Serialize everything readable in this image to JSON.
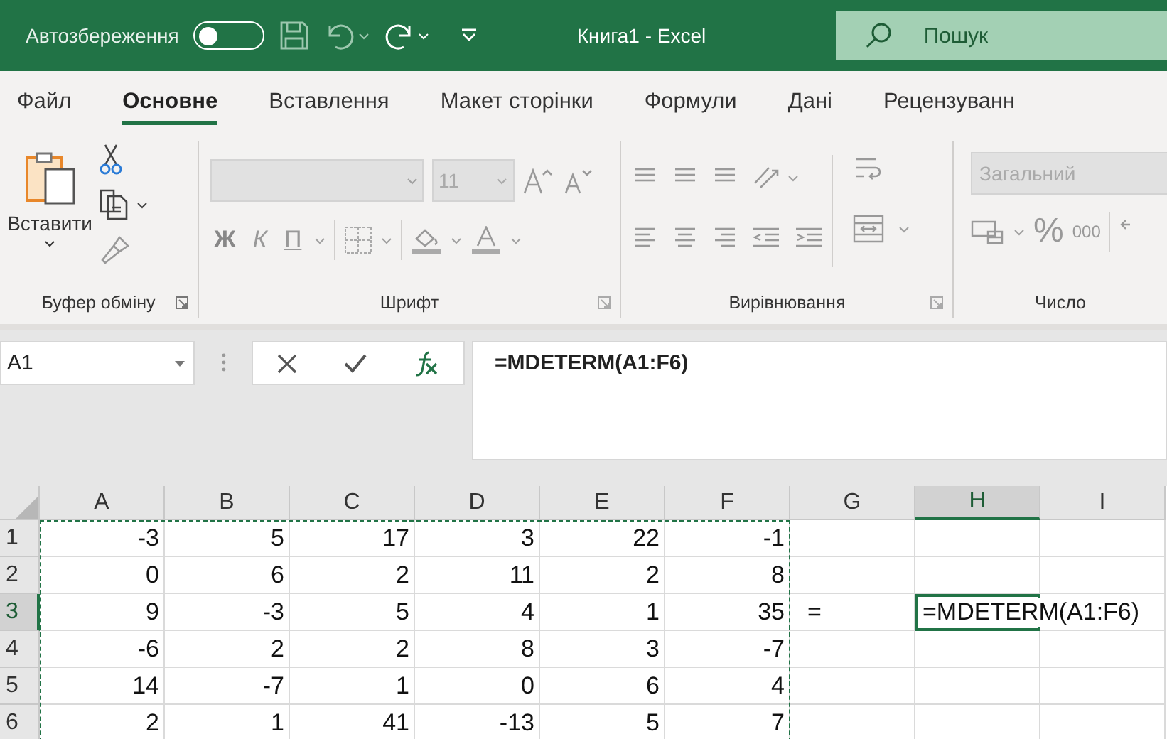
{
  "title_bar": {
    "autosave_label": "Автозбереження",
    "autosave_on": false,
    "title": "Книга1  -  Excel",
    "search_placeholder": "Пошук"
  },
  "tabs": [
    {
      "label": "Файл",
      "selected": false
    },
    {
      "label": "Основне",
      "selected": true
    },
    {
      "label": "Вставлення",
      "selected": false
    },
    {
      "label": "Макет сторінки",
      "selected": false
    },
    {
      "label": "Формули",
      "selected": false
    },
    {
      "label": "Дані",
      "selected": false
    },
    {
      "label": "Рецензуванн",
      "selected": false
    }
  ],
  "ribbon": {
    "clipboard": {
      "label": "Буфер обміну",
      "paste_label": "Вставити"
    },
    "font": {
      "label": "Шрифт",
      "disabled": true,
      "size": "11",
      "bold": "Ж",
      "italic": "К",
      "underline": "П"
    },
    "alignment": {
      "label": "Вирівнювання",
      "disabled": true
    },
    "number": {
      "label": "Число",
      "disabled": true,
      "format": "Загальний",
      "percent": "%",
      "thousands": "000"
    }
  },
  "formula_bar": {
    "name_box": "A1",
    "formula": "=MDETERM(A1:F6)"
  },
  "grid": {
    "copy_marquee": true,
    "columns": [
      {
        "label": "A",
        "selected": false
      },
      {
        "label": "B",
        "selected": false
      },
      {
        "label": "C",
        "selected": false
      },
      {
        "label": "D",
        "selected": false
      },
      {
        "label": "E",
        "selected": false
      },
      {
        "label": "F",
        "selected": false
      },
      {
        "label": "G",
        "selected": false
      },
      {
        "label": "H",
        "selected": true
      },
      {
        "label": "I",
        "selected": false
      }
    ],
    "rows": [
      {
        "label": "1",
        "selected": false,
        "cells": [
          "-3",
          "5",
          "17",
          "3",
          "22",
          "-1",
          "",
          "",
          ""
        ]
      },
      {
        "label": "2",
        "selected": false,
        "cells": [
          "0",
          "6",
          "2",
          "11",
          "2",
          "8",
          "",
          "",
          ""
        ]
      },
      {
        "label": "3",
        "selected": true,
        "cells": [
          "9",
          "-3",
          "5",
          "4",
          "1",
          "35",
          "=",
          "=MDETERM(A1:F6)",
          ""
        ]
      },
      {
        "label": "4",
        "selected": false,
        "cells": [
          "-6",
          "2",
          "2",
          "8",
          "3",
          "-7",
          "",
          "",
          ""
        ]
      },
      {
        "label": "5",
        "selected": false,
        "cells": [
          "14",
          "-7",
          "1",
          "0",
          "6",
          "4",
          "",
          "",
          ""
        ]
      },
      {
        "label": "6",
        "selected": false,
        "cells": [
          "2",
          "1",
          "41",
          "-13",
          "5",
          "7",
          "",
          "",
          ""
        ]
      }
    ]
  }
}
